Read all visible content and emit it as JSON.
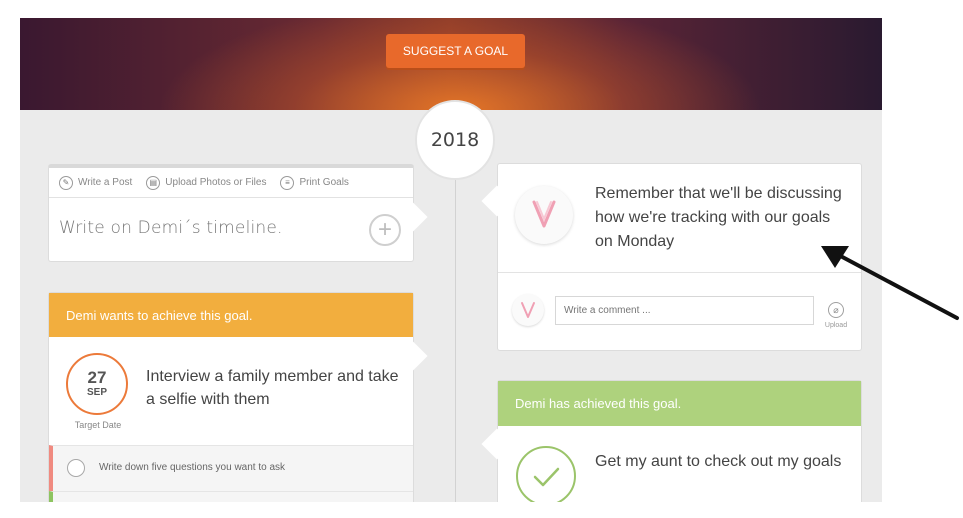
{
  "header": {
    "suggest_button": "SUGGEST A GOAL"
  },
  "timeline": {
    "year": "2018"
  },
  "composer": {
    "tabs": [
      {
        "label": "Write a Post",
        "icon": "pencil-icon"
      },
      {
        "label": "Upload Photos or Files",
        "icon": "upload-icon"
      },
      {
        "label": "Print Goals",
        "icon": "print-icon"
      }
    ],
    "placeholder": "Write on Demi´s timeline."
  },
  "goal": {
    "header": "Demi wants to achieve this goal.",
    "day": "27",
    "month": "SEP",
    "target_label": "Target Date",
    "title": "Interview a family member and take a selfie with them",
    "task": "Write down five questions you want to ask"
  },
  "post": {
    "text": "Remember that we'll be discussing how we're tracking with our goals on Monday",
    "comment_placeholder": "Write a comment ...",
    "upload_label": "Upload"
  },
  "achieved": {
    "header": "Demi has achieved this goal.",
    "title": "Get my aunt to check out my goals"
  },
  "colors": {
    "accent_orange": "#e8692b",
    "goal_header": "#f2ae3e",
    "achieved_header": "#aed27d",
    "page_bg": "#ebebeb"
  }
}
